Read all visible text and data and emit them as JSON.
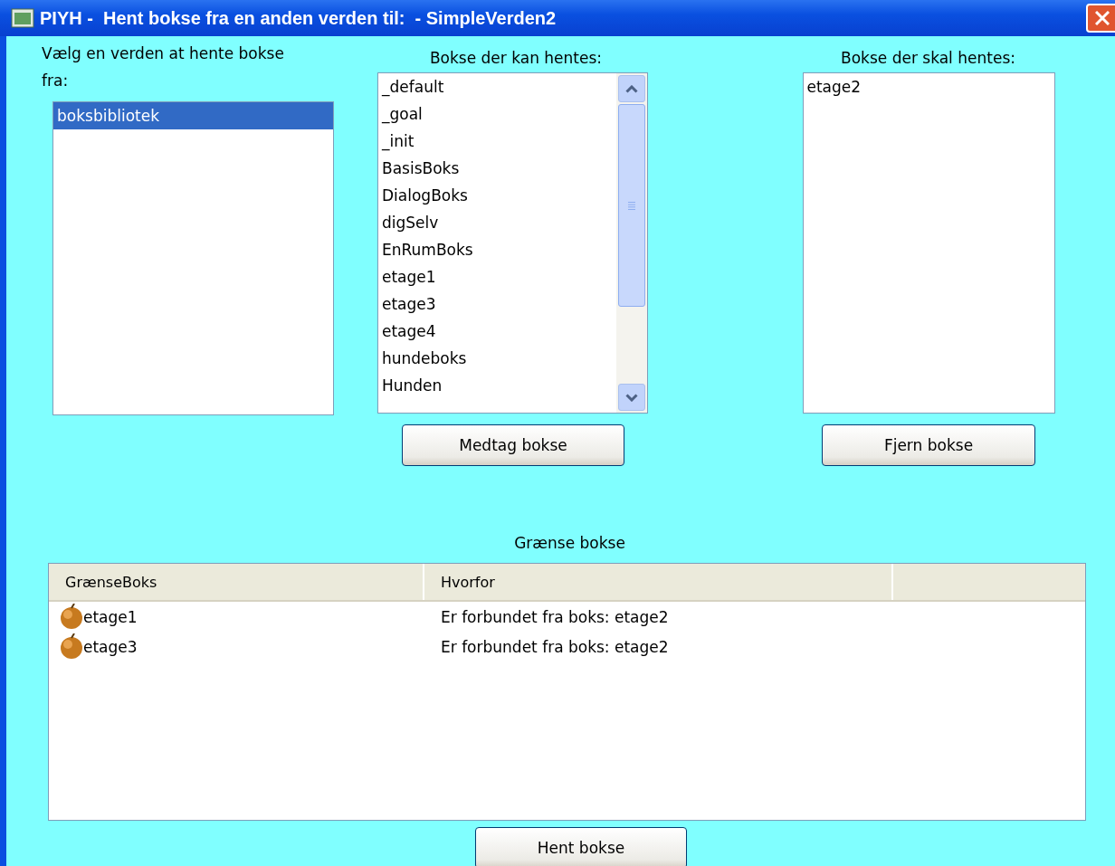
{
  "window": {
    "title": "PIYH -  Hent bokse fra en anden verden til:  - SimpleVerden2"
  },
  "source_worlds": {
    "label": "Vælg en verden at hente bokse fra:",
    "items": [
      {
        "text": "boksbibliotek",
        "selected": true
      }
    ]
  },
  "available": {
    "label": "Bokse der kan hentes:",
    "items": [
      {
        "text": "_default",
        "selected": false
      },
      {
        "text": "_goal",
        "selected": false
      },
      {
        "text": "_init",
        "selected": false
      },
      {
        "text": "BasisBoks",
        "selected": false
      },
      {
        "text": "DialogBoks",
        "selected": false
      },
      {
        "text": "digSelv",
        "selected": false
      },
      {
        "text": "EnRumBoks",
        "selected": false
      },
      {
        "text": "etage1",
        "selected": false
      },
      {
        "text": "etage3",
        "selected": false
      },
      {
        "text": "etage4",
        "selected": false
      },
      {
        "text": "hundeboks",
        "selected": false
      },
      {
        "text": "Hunden",
        "selected": false
      }
    ],
    "button": "Medtag bokse"
  },
  "chosen": {
    "label": "Bokse der skal hentes:",
    "items": [
      {
        "text": "etage2",
        "selected": false
      }
    ],
    "button": "Fjern bokse"
  },
  "border_boxes": {
    "label": "Grænse bokse",
    "columns": [
      "GrænseBoks",
      "Hvorfor"
    ],
    "rows": [
      {
        "box": "etage1",
        "reason": "Er forbundet fra boks: etage2"
      },
      {
        "box": "etage3",
        "reason": "Er forbundet fra boks: etage2"
      }
    ]
  },
  "buttons": [
    "Hent bokse"
  ]
}
